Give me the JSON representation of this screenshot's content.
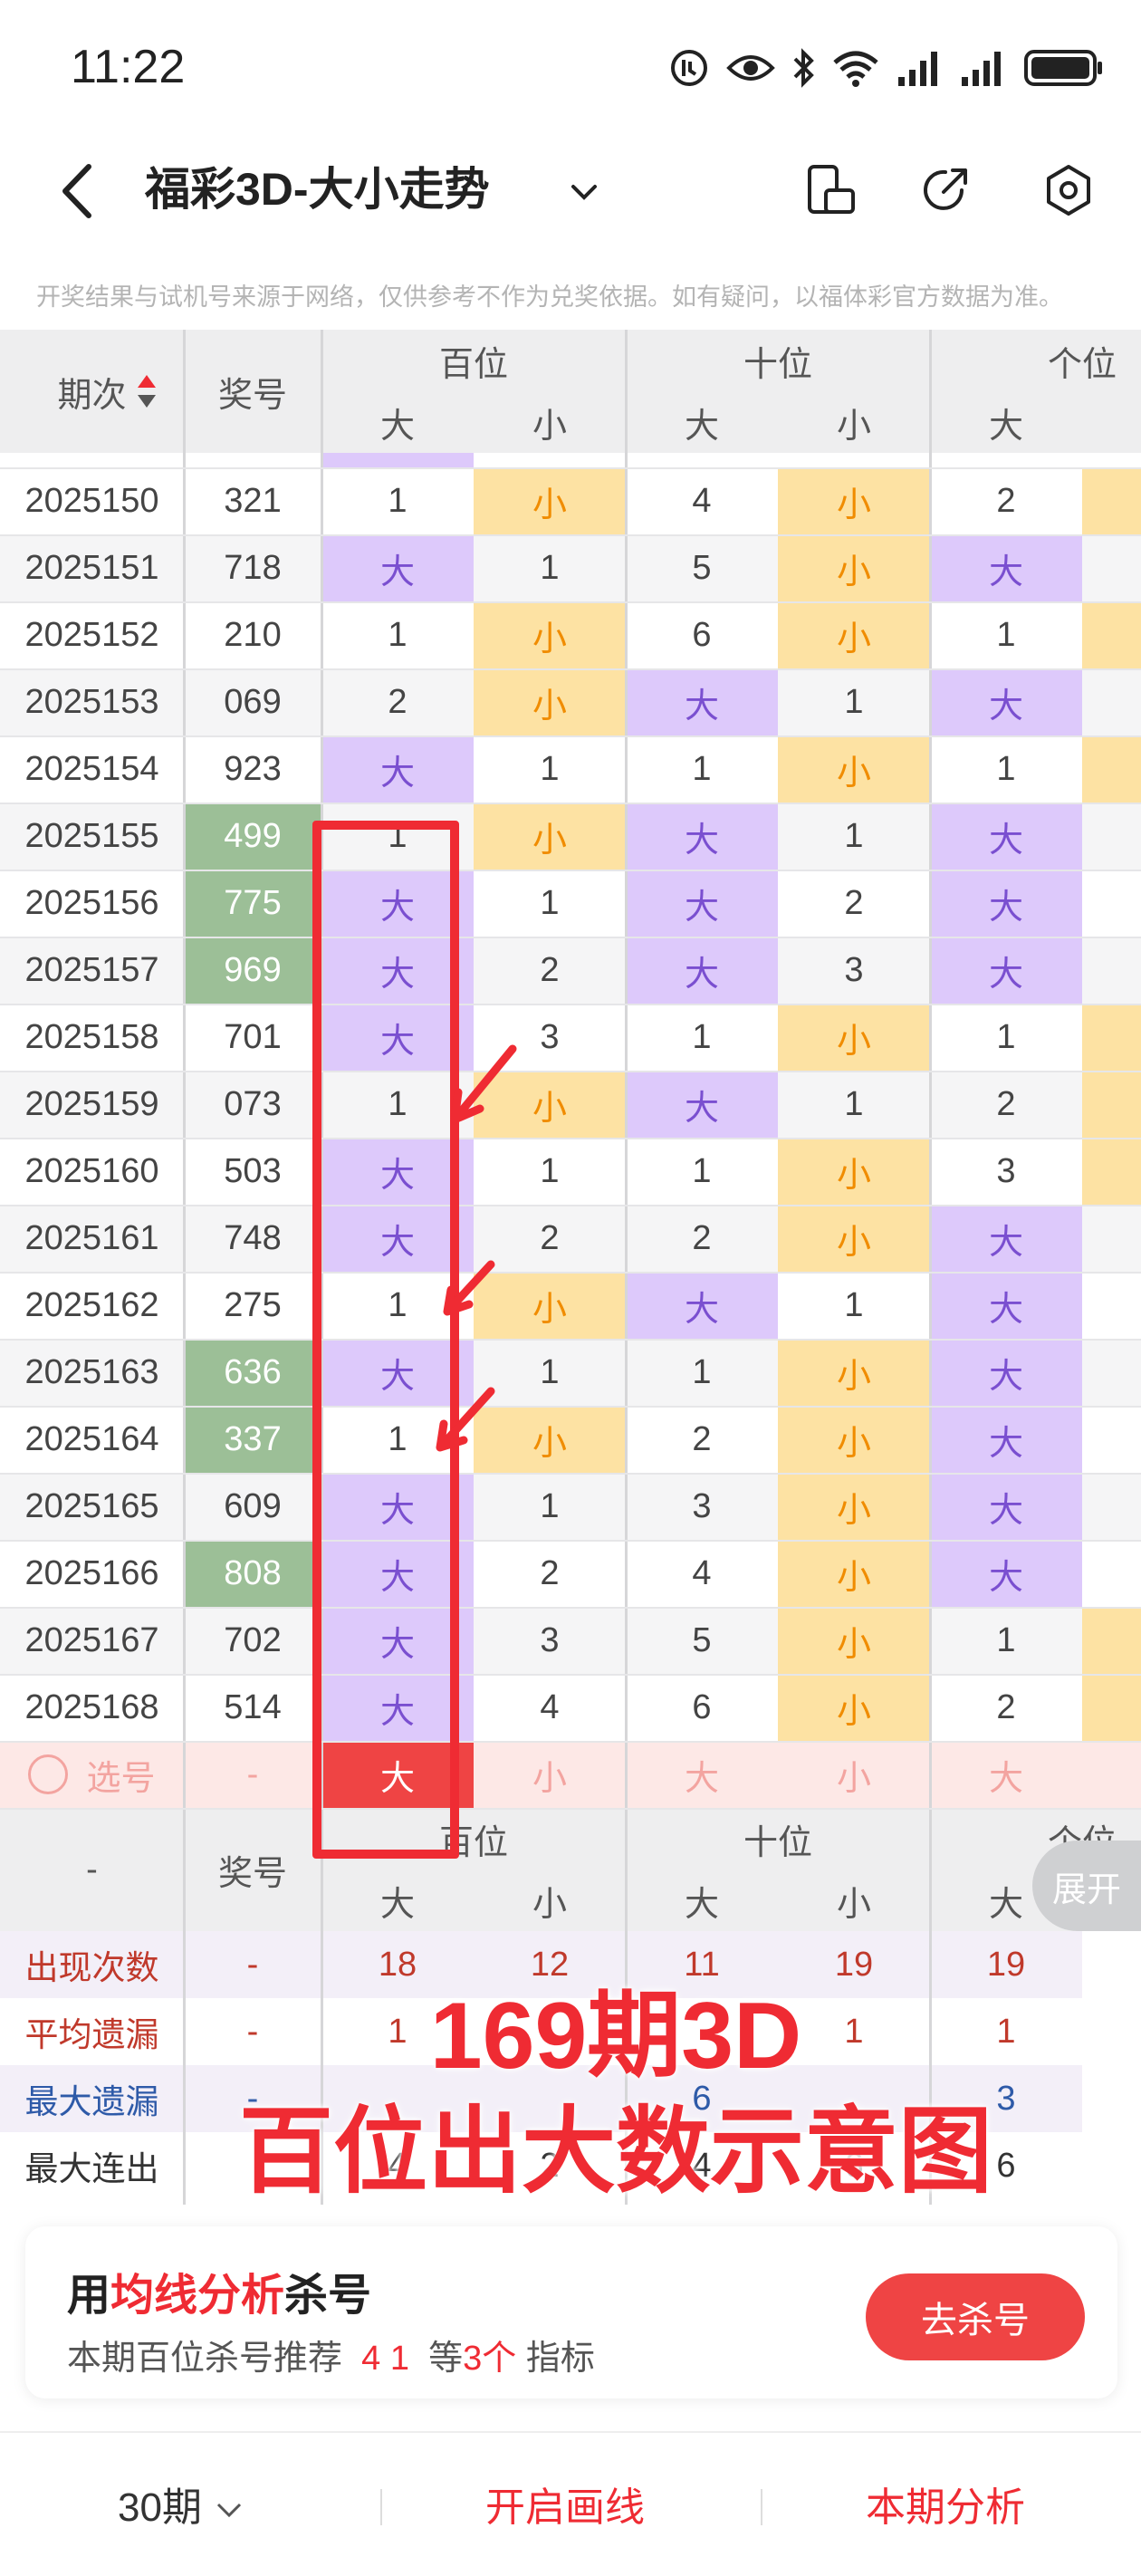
{
  "status": {
    "time": "11:22"
  },
  "nav": {
    "title": "福彩3D-大小走势"
  },
  "notice": "开奖结果与试机号来源于网络，仅供参考不作为兑奖依据。如有疑问，以福体彩官方数据为准。",
  "table": {
    "period_header": "期次",
    "number_header": "奖号",
    "groups": [
      "百位",
      "十位",
      "个位"
    ],
    "sub": [
      "大",
      "小"
    ],
    "rows": [
      {
        "p": "2025150",
        "n": "321",
        "hl": false,
        "c": [
          "1",
          "小",
          "4",
          "小",
          "2"
        ]
      },
      {
        "p": "2025151",
        "n": "718",
        "hl": false,
        "c": [
          "大",
          "1",
          "5",
          "小",
          "大"
        ]
      },
      {
        "p": "2025152",
        "n": "210",
        "hl": false,
        "c": [
          "1",
          "小",
          "6",
          "小",
          "1"
        ]
      },
      {
        "p": "2025153",
        "n": "069",
        "hl": false,
        "c": [
          "2",
          "小",
          "大",
          "1",
          "大"
        ]
      },
      {
        "p": "2025154",
        "n": "923",
        "hl": false,
        "c": [
          "大",
          "1",
          "1",
          "小",
          "1"
        ]
      },
      {
        "p": "2025155",
        "n": "499",
        "hl": true,
        "c": [
          "1",
          "小",
          "大",
          "1",
          "大"
        ]
      },
      {
        "p": "2025156",
        "n": "775",
        "hl": true,
        "c": [
          "大",
          "1",
          "大",
          "2",
          "大"
        ]
      },
      {
        "p": "2025157",
        "n": "969",
        "hl": true,
        "c": [
          "大",
          "2",
          "大",
          "3",
          "大"
        ]
      },
      {
        "p": "2025158",
        "n": "701",
        "hl": false,
        "c": [
          "大",
          "3",
          "1",
          "小",
          "1"
        ]
      },
      {
        "p": "2025159",
        "n": "073",
        "hl": false,
        "c": [
          "1",
          "小",
          "大",
          "1",
          "2"
        ]
      },
      {
        "p": "2025160",
        "n": "503",
        "hl": false,
        "c": [
          "大",
          "1",
          "1",
          "小",
          "3"
        ]
      },
      {
        "p": "2025161",
        "n": "748",
        "hl": false,
        "c": [
          "大",
          "2",
          "2",
          "小",
          "大"
        ]
      },
      {
        "p": "2025162",
        "n": "275",
        "hl": false,
        "c": [
          "1",
          "小",
          "大",
          "1",
          "大"
        ]
      },
      {
        "p": "2025163",
        "n": "636",
        "hl": true,
        "c": [
          "大",
          "1",
          "1",
          "小",
          "大"
        ]
      },
      {
        "p": "2025164",
        "n": "337",
        "hl": true,
        "c": [
          "1",
          "小",
          "2",
          "小",
          "大"
        ]
      },
      {
        "p": "2025165",
        "n": "609",
        "hl": false,
        "c": [
          "大",
          "1",
          "3",
          "小",
          "大"
        ]
      },
      {
        "p": "2025166",
        "n": "808",
        "hl": true,
        "c": [
          "大",
          "2",
          "4",
          "小",
          "大"
        ]
      },
      {
        "p": "2025167",
        "n": "702",
        "hl": false,
        "c": [
          "大",
          "3",
          "5",
          "小",
          "1"
        ]
      },
      {
        "p": "2025168",
        "n": "514",
        "hl": false,
        "c": [
          "大",
          "4",
          "6",
          "小",
          "2"
        ]
      }
    ],
    "select_row": {
      "label": "选号",
      "n": "-",
      "c": [
        "大",
        "小",
        "大",
        "小",
        "大"
      ]
    },
    "footer_header": {
      "dash": "-",
      "n": "奖号"
    },
    "stats": [
      {
        "label": "出现次数",
        "dash": "-",
        "v": [
          "18",
          "12",
          "11",
          "19",
          "19"
        ]
      },
      {
        "label": "平均遗漏",
        "dash": "-",
        "v": [
          "1",
          "",
          "",
          "1",
          "1"
        ]
      },
      {
        "label": "最大遗漏",
        "dash": "-",
        "v": [
          "",
          "",
          "6",
          "",
          "3"
        ]
      },
      {
        "label": "最大连出",
        "dash": "",
        "v": [
          "4",
          "2",
          "4",
          "6",
          "6"
        ]
      }
    ],
    "expand": "展开"
  },
  "overlay": {
    "line1": "169期3D",
    "line2": "百位出大数示意图"
  },
  "card": {
    "title_pre": "用",
    "title_hl": "均线分析",
    "title_post": "杀号",
    "sub_pre": "本期百位杀号推荐",
    "sub_nums": "4 1",
    "sub_mid": "等",
    "sub_cnt": "3个",
    "sub_post": "指标",
    "button": "去杀号"
  },
  "bottom": {
    "periods": "30期",
    "draw": "开启画线",
    "analysis": "本期分析"
  },
  "colors": {
    "big": "#ddc9fb",
    "small": "#fde2a3",
    "hl_num": "#9cbf97",
    "red": "#ef2b33",
    "big_text": "#7a4fd0",
    "small_text": "#f08c00"
  }
}
